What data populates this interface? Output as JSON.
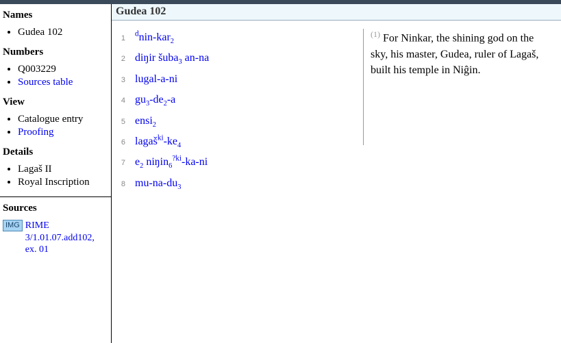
{
  "sidebar": {
    "names_heading": "Names",
    "names": [
      {
        "label": "Gudea 102",
        "link": false
      }
    ],
    "numbers_heading": "Numbers",
    "numbers": [
      {
        "label": "Q003229",
        "link": false
      },
      {
        "label": "Sources table",
        "link": true
      }
    ],
    "view_heading": "View",
    "view": [
      {
        "label": "Catalogue entry",
        "link": false
      },
      {
        "label": "Proofing",
        "link": true
      }
    ],
    "details_heading": "Details",
    "details": [
      {
        "label": "Lagaš II",
        "link": false
      },
      {
        "label": "Royal Inscription",
        "link": false
      }
    ],
    "sources_heading": "Sources",
    "img_badge": "IMG",
    "source_link": "RIME 3/1.01.07.add102, ex. 01"
  },
  "doc_title": "Gudea 102",
  "transliteration": [
    {
      "n": "1",
      "html": "<sup>d</sup>nin-kar<sub>2</sub>"
    },
    {
      "n": "2",
      "html": "diŋir šuba<sub>3</sub> an-na"
    },
    {
      "n": "3",
      "html": "lugal-a-ni"
    },
    {
      "n": "4",
      "html": "gu<sub>3</sub>-de<sub>2</sub>-a"
    },
    {
      "n": "5",
      "html": "ensi<sub>2</sub>"
    },
    {
      "n": "6",
      "html": "lagaš<sup>ki</sup>-ke<sub>4</sub>"
    },
    {
      "n": "7",
      "html": "e<sub>2</sub> niŋin<sub>6</sub><sup>?ki</sup>-ka-ni"
    },
    {
      "n": "8",
      "html": "mu-na-du<sub>3</sub>"
    }
  ],
  "translation": {
    "marker": "(1)",
    "text": "For Ninkar, the shining god on the sky, his master, Gudea, ruler of Lagaš, built his temple in Niĝin."
  }
}
